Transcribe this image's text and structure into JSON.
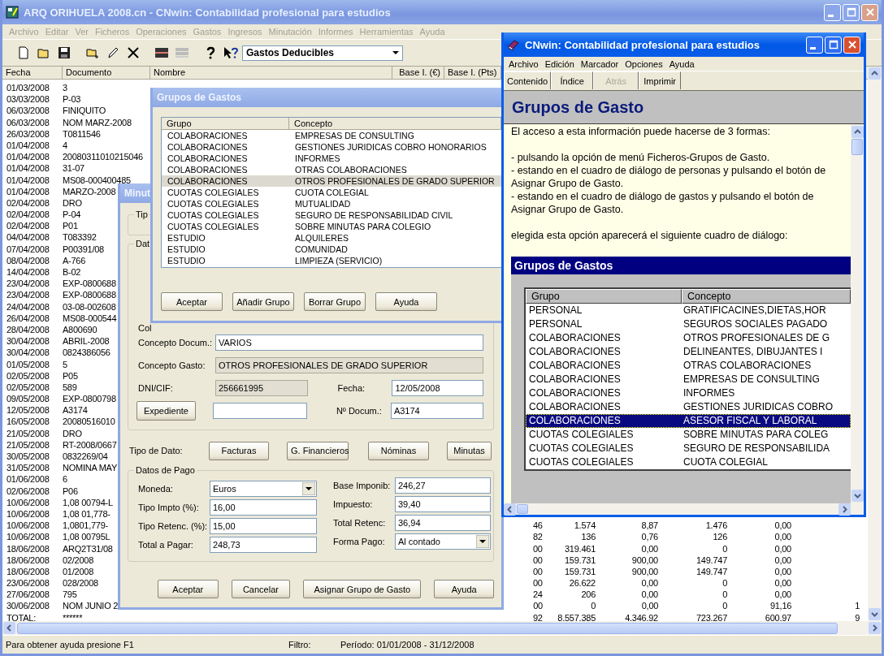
{
  "main_window": {
    "title": "ARQ ORIHUELA 2008.cn - CNwin: Contabilidad profesional para estudios",
    "menu": [
      "Archivo",
      "Editar",
      "Ver",
      "Ficheros",
      "Operaciones",
      "Gastos",
      "Ingresos",
      "Minutación",
      "Informes",
      "Herramientas",
      "Ayuda"
    ],
    "toolbar": {
      "combo_value": "Gastos Deducibles"
    }
  },
  "table": {
    "columns": [
      "Fecha",
      "Documento",
      "Nombre",
      "Base I. (€)",
      "Base I. (Pts)"
    ],
    "rows": [
      {
        "fecha": "01/03/2008",
        "documento": "3"
      },
      {
        "fecha": "03/03/2008",
        "documento": "P-03"
      },
      {
        "fecha": "06/03/2008",
        "documento": "FINIQUITO"
      },
      {
        "fecha": "06/03/2008",
        "documento": "NOM MARZ-2008"
      },
      {
        "fecha": "26/03/2008",
        "documento": "T0811546"
      },
      {
        "fecha": "01/04/2008",
        "documento": "4"
      },
      {
        "fecha": "01/04/2008",
        "documento": "20080311010215046"
      },
      {
        "fecha": "01/04/2008",
        "documento": "31-07"
      },
      {
        "fecha": "01/04/2008",
        "documento": "MS08-000400485"
      },
      {
        "fecha": "01/04/2008",
        "documento": "MARZO-2008"
      },
      {
        "fecha": "02/04/2008",
        "documento": "DRO"
      },
      {
        "fecha": "02/04/2008",
        "documento": "P-04"
      },
      {
        "fecha": "02/04/2008",
        "documento": "P01"
      },
      {
        "fecha": "04/04/2008",
        "documento": "T083392"
      },
      {
        "fecha": "07/04/2008",
        "documento": "P00391/08"
      },
      {
        "fecha": "08/04/2008",
        "documento": "A-766"
      },
      {
        "fecha": "14/04/2008",
        "documento": "B-02"
      },
      {
        "fecha": "23/04/2008",
        "documento": "EXP-0800688"
      },
      {
        "fecha": "23/04/2008",
        "documento": "EXP-0800688"
      },
      {
        "fecha": "24/04/2008",
        "documento": "03-08-002608"
      },
      {
        "fecha": "26/04/2008",
        "documento": "MS08-000544"
      },
      {
        "fecha": "28/04/2008",
        "documento": "A800690"
      },
      {
        "fecha": "30/04/2008",
        "documento": "ABRIL-2008"
      },
      {
        "fecha": "30/04/2008",
        "documento": "0824386056"
      },
      {
        "fecha": "01/05/2008",
        "documento": "5"
      },
      {
        "fecha": "02/05/2008",
        "documento": "P05"
      },
      {
        "fecha": "02/05/2008",
        "documento": "589"
      },
      {
        "fecha": "09/05/2008",
        "documento": "EXP-0800798"
      },
      {
        "fecha": "12/05/2008",
        "documento": "A3174"
      },
      {
        "fecha": "16/05/2008",
        "documento": "20080516010"
      },
      {
        "fecha": "21/05/2008",
        "documento": "DRO"
      },
      {
        "fecha": "21/05/2008",
        "documento": "RT-2008/0667"
      },
      {
        "fecha": "30/05/2008",
        "documento": "0832269/04"
      },
      {
        "fecha": "31/05/2008",
        "documento": "NOMINA MAY"
      },
      {
        "fecha": "01/06/2008",
        "documento": "6"
      },
      {
        "fecha": "02/06/2008",
        "documento": "P06"
      },
      {
        "fecha": "10/06/2008",
        "documento": "1,08 00794-L"
      },
      {
        "fecha": "10/06/2008",
        "documento": "1,08 01,778-"
      },
      {
        "fecha": "10/06/2008",
        "documento": "1,0801,779-",
        "values": [
          "46",
          "1.574",
          "8,87",
          "1.476",
          "0,00"
        ]
      },
      {
        "fecha": "10/06/2008",
        "documento": "1,08 00795L",
        "values": [
          "82",
          "136",
          "0,76",
          "126",
          "0,00"
        ]
      },
      {
        "fecha": "18/06/2008",
        "documento": "ARQ2T31/08",
        "values": [
          "00",
          "319.461",
          "0,00",
          "0",
          "0,00"
        ]
      },
      {
        "fecha": "18/06/2008",
        "documento": "02/2008",
        "values": [
          "00",
          "159.731",
          "900,00",
          "149.747",
          "0,00"
        ]
      },
      {
        "fecha": "18/06/2008",
        "documento": "01/2008",
        "values": [
          "00",
          "159.731",
          "900,00",
          "149.747",
          "0,00"
        ]
      },
      {
        "fecha": "23/06/2008",
        "documento": "028/2008",
        "values": [
          "00",
          "26.622",
          "0,00",
          "0",
          "0,00"
        ]
      },
      {
        "fecha": "27/06/2008",
        "documento": "795",
        "values": [
          "24",
          "206",
          "0,00",
          "0",
          "0,00"
        ]
      },
      {
        "fecha": "30/06/2008",
        "documento": "NOM JUNIO 2",
        "values": [
          "00",
          "0",
          "0,00",
          "0",
          "91,16",
          "1"
        ]
      },
      {
        "fecha": "TOTAL:",
        "documento": "******",
        "values": [
          "92",
          "8.557.385",
          "4.346,92",
          "723.267",
          "600,97",
          "9"
        ]
      }
    ]
  },
  "status_bar": [
    "Para obtener ayuda presione F1",
    "Filtro:",
    "Período: 01/01/2008 - 31/12/2008"
  ],
  "minuta_dialog": {
    "title": "Minut",
    "group_1": "Tip",
    "group_2": "Dat",
    "cut_label": "Col",
    "fields": [
      {
        "label": "Concepto Docum.:",
        "value": "VARIOS",
        "readonly": false
      },
      {
        "label": "Concepto Gasto:",
        "value": "OTROS PROFESIONALES DE GRADO SUPERIOR",
        "readonly": true
      }
    ],
    "dni": {
      "label": "DNI/CIF:",
      "value": "256661995",
      "readonly": true
    },
    "fecha": {
      "label": "Fecha:",
      "value": "12/05/2008",
      "readonly": false
    },
    "expediente_button": "Expediente",
    "num_docum": {
      "label": "Nº Docum.:",
      "value": "A3174",
      "readonly": false
    },
    "tipo_dato": {
      "label": "Tipo de Dato:",
      "buttons": [
        "Facturas",
        "G. Financieros",
        "Nóminas",
        "Minutas"
      ]
    },
    "pago": {
      "title": "Datos de Pago",
      "left": [
        {
          "label": "Moneda:",
          "value": "Euros",
          "kind": "select"
        },
        {
          "label": "Tipo Impto (%):",
          "value": "16,00",
          "kind": "text"
        },
        {
          "label": "Tipo Retenc. (%):",
          "value": "15,00",
          "kind": "text"
        },
        {
          "label": "Total a Pagar:",
          "value": "248,73",
          "kind": "text"
        }
      ],
      "right": [
        {
          "label": "Base Imponib:",
          "value": "246,27",
          "kind": "text"
        },
        {
          "label": "Impuesto:",
          "value": "39,40",
          "kind": "text"
        },
        {
          "label": "Total Retenc:",
          "value": "36,94",
          "kind": "text"
        },
        {
          "label": "Forma Pago:",
          "value": "Al contado",
          "kind": "select"
        }
      ]
    },
    "buttons": [
      "Aceptar",
      "Cancelar",
      "Asignar Grupo de Gasto",
      "Ayuda"
    ]
  },
  "grupos_dialog": {
    "title": "Grupos de Gastos",
    "columns": [
      "Grupo",
      "Concepto"
    ],
    "rows": [
      {
        "grupo": "COLABORACIONES",
        "concepto": "EMPRESAS DE CONSULTING",
        "selected": false
      },
      {
        "grupo": "COLABORACIONES",
        "concepto": "GESTIONES JURIDICAS COBRO HONORARIOS",
        "selected": false
      },
      {
        "grupo": "COLABORACIONES",
        "concepto": "INFORMES",
        "selected": false
      },
      {
        "grupo": "COLABORACIONES",
        "concepto": "OTRAS COLABORACIONES",
        "selected": false
      },
      {
        "grupo": "COLABORACIONES",
        "concepto": "OTROS PROFESIONALES DE GRADO SUPERIOR",
        "selected": true
      },
      {
        "grupo": "CUOTAS COLEGIALES",
        "concepto": "CUOTA COLEGIAL",
        "selected": false
      },
      {
        "grupo": "CUOTAS COLEGIALES",
        "concepto": "MUTUALIDAD",
        "selected": false
      },
      {
        "grupo": "CUOTAS COLEGIALES",
        "concepto": "SEGURO DE RESPONSABILIDAD CIVIL",
        "selected": false
      },
      {
        "grupo": "CUOTAS COLEGIALES",
        "concepto": "SOBRE MINUTAS PARA COLEGIO",
        "selected": false
      },
      {
        "grupo": "ESTUDIO",
        "concepto": "ALQUILERES",
        "selected": false
      },
      {
        "grupo": "ESTUDIO",
        "concepto": "COMUNIDAD",
        "selected": false
      },
      {
        "grupo": "ESTUDIO",
        "concepto": "LIMPIEZA (SERVICIO)",
        "selected": false
      }
    ],
    "buttons": [
      "Aceptar",
      "Añadir Grupo",
      "Borrar Grupo",
      "Ayuda"
    ]
  },
  "help_window": {
    "title": "CNwin: Contabilidad profesional para estudios",
    "menu": [
      "Archivo",
      "Edición",
      "Marcador",
      "Opciones",
      "Ayuda"
    ],
    "buttons": [
      {
        "label": "Contenido",
        "disabled": false
      },
      {
        "label": "Índice",
        "disabled": false
      },
      {
        "label": "Atrás",
        "disabled": true
      },
      {
        "label": "Imprimir",
        "disabled": false
      }
    ],
    "heading": "Grupos de Gasto",
    "paragraphs": [
      "El acceso a esta información puede hacerse de 3 formas:",
      "- pulsando la opción de menú Ficheros-Grupos de Gasto.",
      "- estando en el cuadro de diálogo de personas y pulsando el botón de Asignar Grupo de Gasto.",
      "- estando en el cuadro de diálogo de gastos y pulsando el botón de Asignar Grupo de Gasto.",
      "elegida esta opción aparecerá el siguiente cuadro de diálogo:"
    ],
    "embedded_dialog": {
      "title": "Grupos de Gastos",
      "columns": [
        "Grupo",
        "Concepto"
      ],
      "rows": [
        {
          "grupo": "PERSONAL",
          "concepto": "GRATIFICACINES,DIETAS,HOR",
          "selected": false
        },
        {
          "grupo": "PERSONAL",
          "concepto": "SEGUROS SOCIALES PAGADO",
          "selected": false
        },
        {
          "grupo": "COLABORACIONES",
          "concepto": "OTROS PROFESIONALES DE G",
          "selected": false
        },
        {
          "grupo": "COLABORACIONES",
          "concepto": "DELINEANTES, DIBUJANTES I",
          "selected": false
        },
        {
          "grupo": "COLABORACIONES",
          "concepto": "OTRAS COLABORACIONES",
          "selected": false
        },
        {
          "grupo": "COLABORACIONES",
          "concepto": "EMPRESAS DE CONSULTING",
          "selected": false
        },
        {
          "grupo": "COLABORACIONES",
          "concepto": "INFORMES",
          "selected": false
        },
        {
          "grupo": "COLABORACIONES",
          "concepto": "GESTIONES JURIDICAS COBRO",
          "selected": false
        },
        {
          "grupo": "COLABORACIONES",
          "concepto": "ASESOR FISCAL Y LABORAL",
          "selected": true
        },
        {
          "grupo": "CUOTAS COLEGIALES",
          "concepto": "SOBRE MINUTAS PARA COLEG",
          "selected": false
        },
        {
          "grupo": "CUOTAS COLEGIALES",
          "concepto": "SEGURO DE RESPONSABILIDA",
          "selected": false
        },
        {
          "grupo": "CUOTAS COLEGIALES",
          "concepto": "CUOTA COLEGIAL",
          "selected": false
        }
      ]
    }
  }
}
